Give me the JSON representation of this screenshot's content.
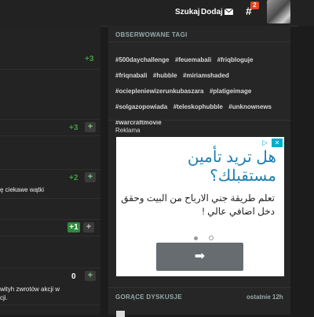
{
  "topbar": {
    "search_label": "Szukaj",
    "add_label": "Dodaj",
    "notification_count": "2"
  },
  "left": {
    "rows": [
      {
        "votes": "+3",
        "has_plus": false,
        "snippet": ""
      },
      {
        "votes": "+3",
        "has_plus": true,
        "snippet": ""
      },
      {
        "votes": "+2",
        "has_plus": true,
        "snippet": "ę ciekawe wątki"
      },
      {
        "votes": "+1",
        "has_plus": true,
        "snippet": ""
      },
      {
        "votes": "0",
        "has_plus": true,
        "snippet_lines": [
          "wityh zwrotów akcji w",
          "cji."
        ]
      }
    ]
  },
  "sidebar": {
    "observed_tags_title": "OBSERWOWANE TAGI",
    "tags": [
      "#500daychallenge",
      "#feuemabali",
      "#friqbloguje",
      "#friqnabali",
      "#hubble",
      "#miriamshaded",
      "#ociepleniewizerunkubaszara",
      "#platigeimage",
      "#solgazopowiada",
      "#teleskophubble",
      "#unknownews",
      "#warcraftmovie"
    ],
    "ad_label": "Reklama",
    "hot_title": "GORĄCE DYSKUSJE",
    "hot_period": "ostatnie 12h"
  },
  "ad": {
    "headline": "هل تريد تأمين مستقبلك؟",
    "body": "تعلم طريقة جني الارباح من البيت وحقق دخل اضافي عالي !",
    "cta_arrow": "➡",
    "accent": "#1b7fb4",
    "adchoice_color": "#00aecd"
  }
}
